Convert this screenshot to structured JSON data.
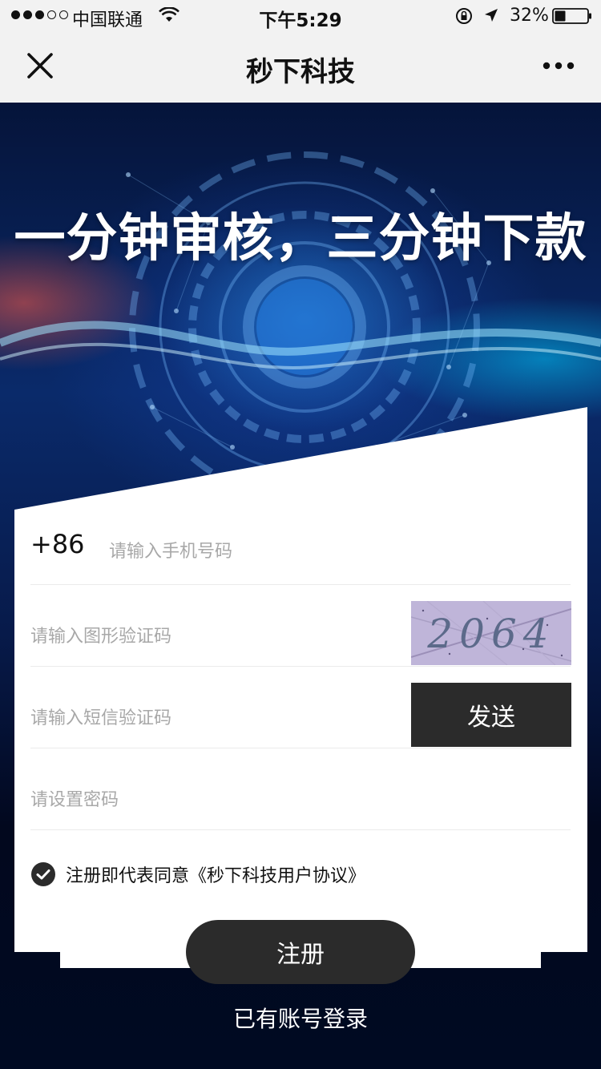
{
  "status_bar": {
    "carrier": "中国联通",
    "time": "下午5:29",
    "battery": "32%",
    "icons": [
      "signal-dots-icon",
      "wifi-icon",
      "orientation-lock-icon",
      "location-arrow-icon",
      "battery-icon"
    ]
  },
  "nav": {
    "title": "秒下科技",
    "close_icon": "close-icon",
    "more_icon": "more-dots-icon"
  },
  "hero": {
    "slogan": "一分钟审核，三分钟下款"
  },
  "form": {
    "country_code": "+86",
    "phone_placeholder": "请输入手机号码",
    "captcha_placeholder": "请输入图形验证码",
    "captcha_text": "2064",
    "sms_placeholder": "请输入短信验证码",
    "send_label": "发送",
    "password_placeholder": "请设置密码",
    "agreement_text": "注册即代表同意《秒下科技用户协议》",
    "agreement_checked": true
  },
  "actions": {
    "register_label": "注册",
    "login_label": "已有账号登录"
  },
  "colors": {
    "button_dark": "#2b2b2b",
    "placeholder": "#a8a8a8",
    "page_bg": "#000a22"
  }
}
